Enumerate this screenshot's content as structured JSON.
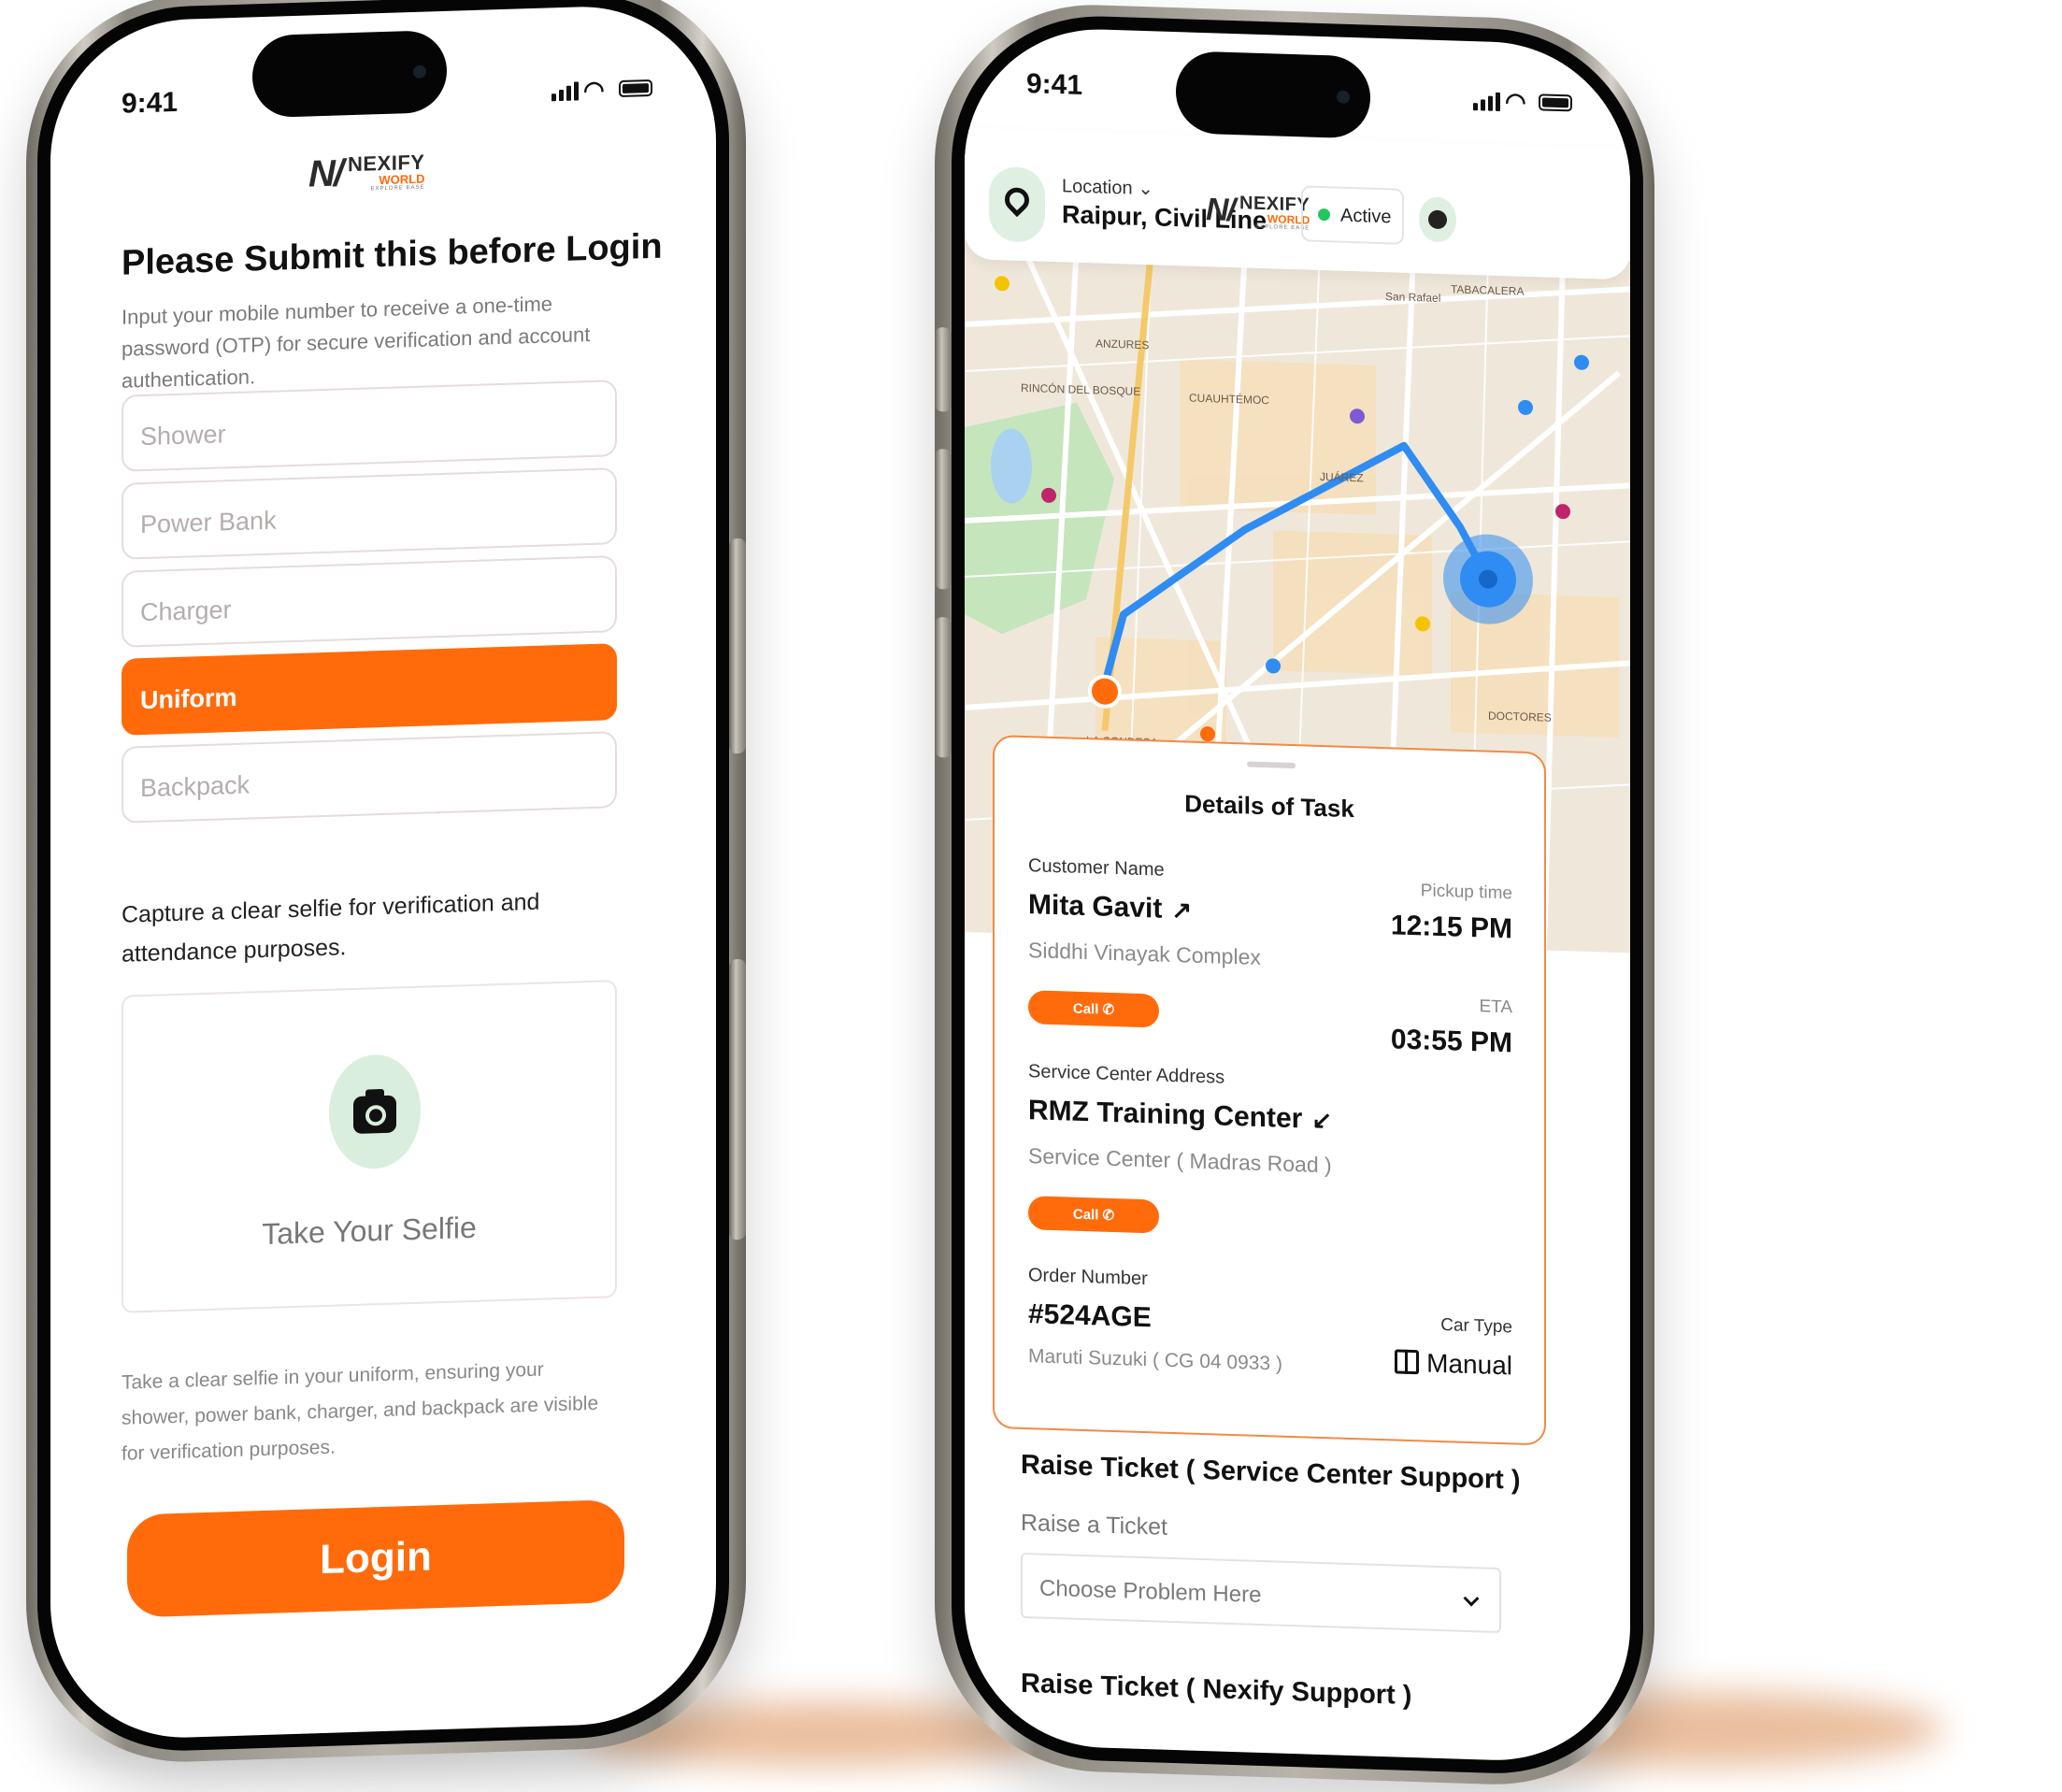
{
  "status_time": "9:41",
  "logo": {
    "mark": "N/",
    "name": "NEXIFY",
    "sub": "WORLD",
    "tagline": "EXPLORE EASE"
  },
  "left": {
    "title": "Please Submit this before Login",
    "subtitle": "Input your mobile number to receive a one-time password (OTP) for secure verification and account authentication.",
    "items": [
      {
        "label": "Shower",
        "selected": false
      },
      {
        "label": "Power Bank",
        "selected": false
      },
      {
        "label": "Charger",
        "selected": false
      },
      {
        "label": "Uniform",
        "selected": true
      },
      {
        "label": "Backpack",
        "selected": false
      }
    ],
    "capture_text": "Capture a clear selfie for verification and attendance purposes.",
    "selfie_label": "Take Your Selfie",
    "footnote": "Take a clear selfie in your uniform, ensuring your shower, power bank, charger, and backpack are visible for verification purposes.",
    "login_label": "Login"
  },
  "right": {
    "location_label": "Location",
    "location_value": "Raipur, Civil Line",
    "status": "Active",
    "map_labels": [
      "ANZURES",
      "RINCÓN DEL BOSQUE",
      "CUAUHTÉMOC",
      "JUÁREZ",
      "LA CONDESA",
      "DOCTORES",
      "TABACALERA",
      "San Rafael"
    ],
    "task": {
      "title": "Details of Task",
      "customer_label": "Customer Name",
      "customer_name": "Mita Gavit",
      "customer_address": "Siddhi Vinayak Complex",
      "call_label": "Call",
      "pickup_label": "Pickup time",
      "pickup_time": "12:15 PM",
      "eta_label": "ETA",
      "eta_time": "03:55 PM",
      "service_label": "Service Center Address",
      "service_name": "RMZ Training Center",
      "service_address": "Service Center ( Madras Road )",
      "order_label": "Order Number",
      "order_number": "#524AGE",
      "car_model": "Maruti Suzuki ( CG 04 0933 )",
      "car_type_label": "Car Type",
      "car_type": "Manual"
    },
    "ticket1_title": "Raise Ticket ( Service Center Support )",
    "ticket_label": "Raise a Ticket",
    "ticket_placeholder": "Choose Problem Here",
    "ticket2_title": "Raise Ticket ( Nexify Support )"
  },
  "colors": {
    "accent": "#ff6b0b",
    "green": "#22c55e",
    "route": "#2f8cf2"
  }
}
